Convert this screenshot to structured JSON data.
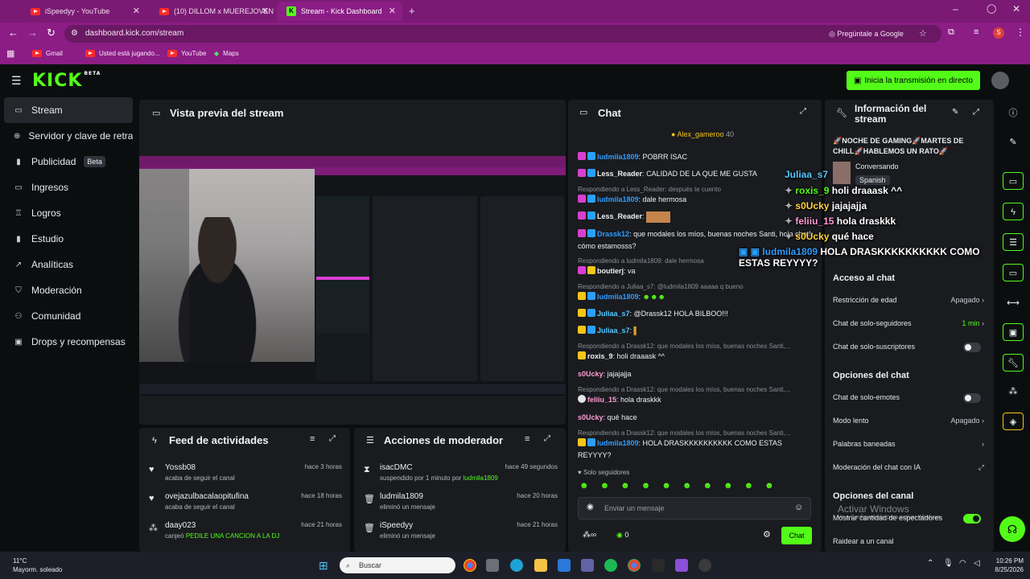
{
  "browser": {
    "tabs": [
      {
        "title": "iSpeedyy - YouTube",
        "icon": "youtube-icon"
      },
      {
        "title": "(10) DILLOM x MUEREJOVEN",
        "icon": "youtube-icon"
      },
      {
        "title": "Stream - Kick Dashboard",
        "icon": "kick-icon",
        "active": true
      }
    ],
    "url": "dashboard.kick.com/stream",
    "ask_google": "Pregúntale a Google",
    "profile_initial": "S",
    "bookmarks": [
      "Gmail",
      "Usted está jugando...",
      "YouTube",
      "Maps"
    ]
  },
  "header": {
    "logo": "KICK",
    "logo_tag": "BETA",
    "go_live_label": "Inicia la transmisión en directo"
  },
  "sidebar": {
    "items": [
      {
        "label": "Stream",
        "icon": "video-icon",
        "active": true
      },
      {
        "label": "Servidor y clave de retransmisión",
        "icon": "link-icon"
      },
      {
        "label": "Publicidad",
        "icon": "ad-icon",
        "badge": "Beta"
      },
      {
        "label": "Ingresos",
        "icon": "card-icon"
      },
      {
        "label": "Logros",
        "icon": "trophy-icon"
      },
      {
        "label": "Estudio",
        "icon": "studio-icon"
      },
      {
        "label": "Analíticas",
        "icon": "chart-icon"
      },
      {
        "label": "Moderación",
        "icon": "shield-icon"
      },
      {
        "label": "Comunidad",
        "icon": "community-icon"
      },
      {
        "label": "Drops y recompensas",
        "icon": "gift-icon"
      }
    ]
  },
  "preview": {
    "title": "Vista previa del stream"
  },
  "feed": {
    "title": "Feed de actividades",
    "items": [
      {
        "name": "Yossb08",
        "action": "acaba de seguir el canal",
        "highlight": "",
        "time": "hace 3 horas",
        "icon": "heart-icon"
      },
      {
        "name": "ovejazulbacalaopitufina",
        "action": "acaba de seguir el canal",
        "highlight": "",
        "time": "hace 18 horas",
        "icon": "heart-icon"
      },
      {
        "name": "daay023",
        "action": "canjeó",
        "highlight": "PEDILE UNA CANCION A LA DJ",
        "time": "hace 21 horas",
        "icon": "reward-icon"
      }
    ]
  },
  "mod": {
    "title": "Acciones de moderador",
    "items": [
      {
        "name": "isacDMC",
        "action": "suspendido por 1 minuto por",
        "highlight": "ludmila1809",
        "time": "hace 49 segundos",
        "icon": "hourglass-icon"
      },
      {
        "name": "ludmila1809",
        "action": "eliminó un mensaje",
        "highlight": "",
        "time": "hace 20 horas",
        "icon": "trash-icon"
      },
      {
        "name": "iSpeedyy",
        "action": "eliminó un mensaje",
        "highlight": "",
        "time": "hace 21 horas",
        "icon": "trash-icon"
      }
    ]
  },
  "chat": {
    "title": "Chat",
    "pinned_user": "Alex_gameroo",
    "pinned_count": "40",
    "messages": [
      {
        "reply": "",
        "user": "ludmila1809",
        "color": "#2f9bff",
        "text": "POBRR ISAC"
      },
      {
        "reply": "",
        "user": "Less_Reader",
        "color": "#e3e5e7",
        "text": "CALIDAD DE LA QUE ME GUSTA"
      },
      {
        "reply": "Respondiendo a Less_Reader: después te cuento",
        "user": "ludmila1809",
        "color": "#2f9bff",
        "text": "dale hermosa"
      },
      {
        "reply": "",
        "user": "Less_Reader",
        "color": "#e3e5e7",
        "text": ""
      },
      {
        "reply": "",
        "user": "Drassk12",
        "color": "#2f9bff",
        "text": "que modales los míos, buenas noches Santi, hola chat! cómo estamosss?"
      },
      {
        "reply": "Respondiendo a ludmila1809: dale hermosa",
        "user": "boutierj",
        "color": "#e3e5e7",
        "text": "va"
      },
      {
        "reply": "Respondiendo a Juliaa_s7: @ludmila1809 aaaaa q bueno",
        "user": "ludmila1809",
        "color": "#2f9bff",
        "text": ""
      },
      {
        "reply": "",
        "user": "Juliaa_s7",
        "color": "#53c8ff",
        "text": "@Drassk12 HOLA BILBOO!!!"
      },
      {
        "reply": "",
        "user": "Juliaa_s7",
        "color": "#53c8ff",
        "text": ""
      },
      {
        "reply": "Respondiendo a Drassk12: que modales los míos, buenas noches Santi,...",
        "user": "roxis_9",
        "color": "#e3e5e7",
        "text": "holi draaask ^^"
      },
      {
        "reply": "",
        "user": "s0Ucky",
        "color": "#ff9ad5",
        "text": "jajajajja"
      },
      {
        "reply": "Respondiendo a Drassk12: que modales los míos, buenas noches Santi,...",
        "user": "feliiu_15",
        "color": "#ff9ad5",
        "text": "hola draskkk"
      },
      {
        "reply": "",
        "user": "s0Ucky",
        "color": "#ff9ad5",
        "text": "qué hace"
      },
      {
        "reply": "Respondiendo a Drassk12: que modales los míos, buenas noches Santi,...",
        "user": "ludmila1809",
        "color": "#2f9bff",
        "text": "HOLA DRASKKKKKKKKKK COMO ESTAS REYYYY?"
      }
    ],
    "followers_only_label": "Solo seguidores",
    "input_placeholder": "Enviar un mensaje",
    "points": "0",
    "send_label": "Chat"
  },
  "info": {
    "title": "Información del stream",
    "stream_title": "🚀NOCHE DE GAMING🚀MARTES DE CHILL🚀HABLEMOS UN RATO🚀",
    "category": "Conversando",
    "language": "Spanish",
    "sections": [
      {
        "heading": "Acceso al chat",
        "rows": [
          {
            "label": "Restricción de edad",
            "value": "Apagado",
            "kind": "chevron"
          },
          {
            "label": "Chat de solo-seguidores",
            "value": "1 min",
            "kind": "chevron",
            "green": true
          },
          {
            "label": "Chat de solo-suscriptores",
            "value": "",
            "kind": "toggle"
          }
        ]
      },
      {
        "heading": "Opciones del chat",
        "rows": [
          {
            "label": "Chat de solo-emotes",
            "value": "",
            "kind": "toggle"
          },
          {
            "label": "Modo lento",
            "value": "Apagado",
            "kind": "chevron"
          },
          {
            "label": "Palabras baneadas",
            "value": "",
            "kind": "chevron"
          },
          {
            "label": "Moderación del chat con IA",
            "value": "",
            "kind": "external"
          }
        ]
      },
      {
        "heading": "Opciones del canal",
        "rows": [
          {
            "label": "Mostrar cantidad de espectadores",
            "value": "",
            "kind": "toggle_on"
          },
          {
            "label": "Raidear a un canal",
            "value": "",
            "kind": "none"
          }
        ]
      }
    ],
    "watermark_title": "Activar Windows",
    "watermark_sub": "Ve a Configuración para activar Windows."
  },
  "overlay": {
    "lines": [
      {
        "user": "Juliaa_s7",
        "color": "#53c8ff",
        "text": ""
      },
      {
        "user": "roxis_9",
        "color": "#53fc18",
        "text": "holi draaask ^^"
      },
      {
        "user": "s0Ucky",
        "color": "#ffd23f",
        "text": "jajajajja"
      },
      {
        "user": "feliiu_15",
        "color": "#ff9ad5",
        "text": "hola draskkk"
      },
      {
        "user": "s0Ucky",
        "color": "#ffd23f",
        "text": "qué hace"
      },
      {
        "user": "ludmila1809",
        "color": "#2f9bff",
        "text": "HOLA DRASKKKKKKKKKK COMO ESTAS REYYYY?"
      }
    ]
  },
  "taskbar": {
    "weather_temp": "11°C",
    "weather_desc": "Mayorm. soleado",
    "search_placeholder": "Buscar",
    "time": "10:26 PM",
    "date": "8/25/2026"
  },
  "colors": {
    "accent": "#53fc18",
    "tabbar": "#7a1a74",
    "panel": "#191b1f"
  }
}
